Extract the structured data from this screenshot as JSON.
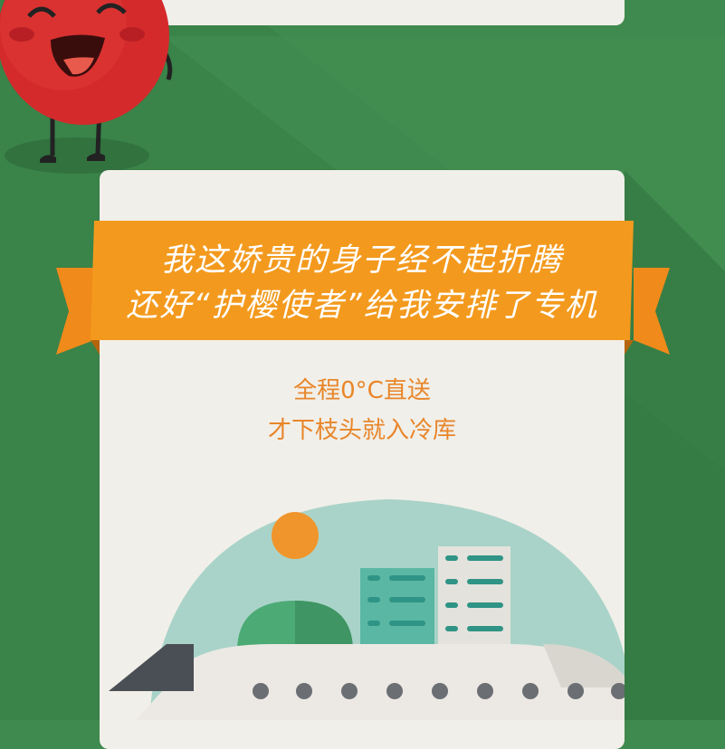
{
  "headline": {
    "line1": "我这娇贵的身子经不起折腾",
    "line2": "还好“护樱使者”给我安排了专机"
  },
  "subtext": {
    "line1": "全程0°C直送",
    "line2": "才下枝头就入冷库"
  },
  "colors": {
    "background_green": "#3f8a4e",
    "dark_green": "#2f6e3d",
    "card": "#f1efe9",
    "ribbon_orange": "#f39a1e",
    "ribbon_dark": "#d97a14",
    "text_orange": "#e8862a",
    "cherry_red": "#d8262c",
    "dome_teal": "#a9d3c8",
    "sun_orange": "#f0952c"
  },
  "icons": {
    "character": "cherry-mascot-icon",
    "sun": "sun-icon",
    "tree": "bush-icon",
    "airplane": "airplane-icon"
  }
}
